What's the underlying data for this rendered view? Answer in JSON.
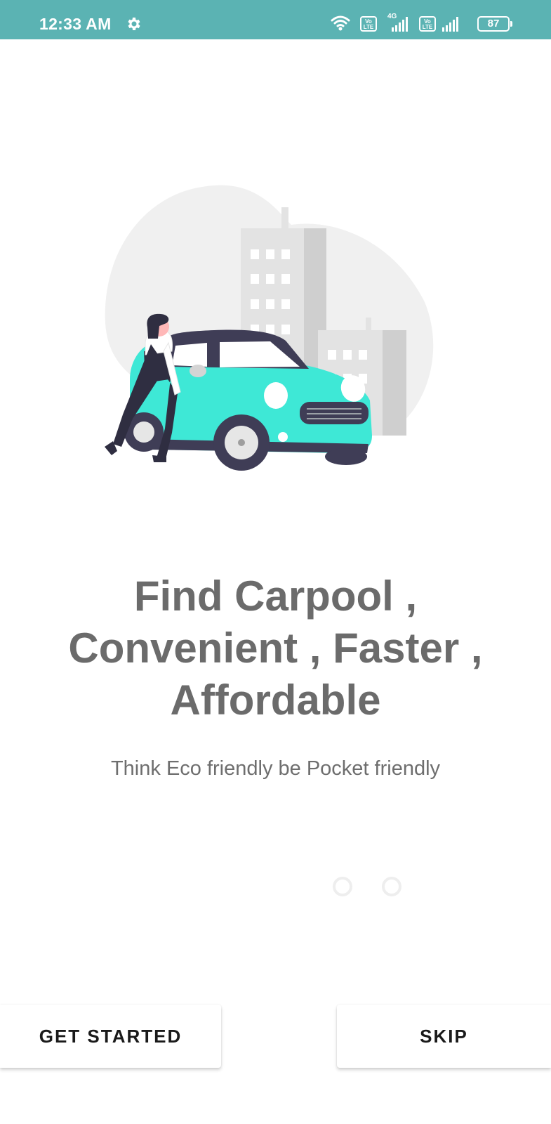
{
  "status_bar": {
    "time": "12:33 AM",
    "network_type": "4G",
    "volte_label": "Vo LTE",
    "battery_level": "87",
    "icons": [
      "settings-gear-icon",
      "wifi-icon",
      "volte-icon",
      "signal-icon",
      "battery-icon"
    ]
  },
  "onboarding": {
    "illustration": "woman-with-car-and-buildings",
    "headline_lines": [
      "Find Carpool ,",
      "Convenient , Faster ,",
      "Affordable"
    ],
    "subtitle": "Think Eco friendly be Pocket friendly",
    "page_indicator": {
      "total": 2
    }
  },
  "actions": {
    "get_started_label": "GET STARTED",
    "skip_label": "SKIP"
  },
  "colors": {
    "status_bar": "#5bb3b3",
    "car_accent": "#3ee8d6",
    "text_gray": "#6b6b6b",
    "dark_navy": "#3f3d56"
  }
}
